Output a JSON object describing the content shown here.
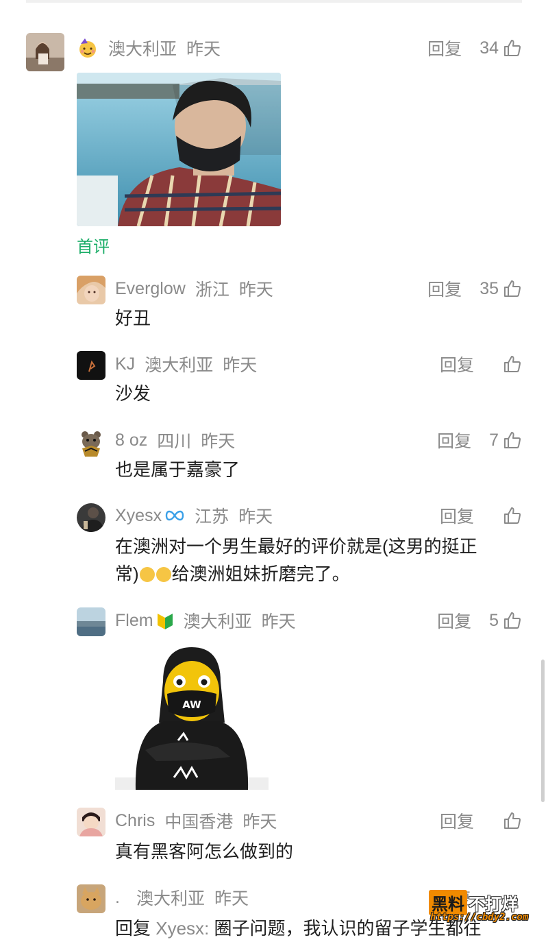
{
  "comments": [
    {
      "name": "",
      "badge_icon": "party-face-emoji",
      "region": "澳大利亚",
      "time": "昨天",
      "reply": "回复",
      "likes": "34",
      "tag": "首评"
    },
    {
      "name": "Everglow",
      "region": "浙江",
      "time": "昨天",
      "reply": "回复",
      "likes": "35",
      "text": "好丑"
    },
    {
      "name": "KJ",
      "region": "澳大利亚",
      "time": "昨天",
      "reply": "回复",
      "likes": "",
      "text": "沙发"
    },
    {
      "name": "8 oz",
      "region": "四川",
      "time": "昨天",
      "reply": "回复",
      "likes": "7",
      "text": "也是属于嘉豪了"
    },
    {
      "name": "Xyesx",
      "badge_icon": "infinity-badge-icon",
      "region": "江苏",
      "time": "昨天",
      "reply": "回复",
      "likes": "",
      "text_line1": "在澳洲对一个男生最好的评价就是(这男的挺正",
      "text_line2_a": "常)",
      "text_line2_b": "给澳洲姐妹折磨完了。"
    },
    {
      "name": "Flem",
      "badge_icon": "beginner-badge-icon",
      "region": "澳大利亚",
      "time": "昨天",
      "reply": "回复",
      "likes": "5"
    },
    {
      "name": "Chris",
      "region": "中国香港",
      "time": "昨天",
      "reply": "回复",
      "likes": "",
      "text": "真有黑客阿怎么做到的"
    },
    {
      "name": ".",
      "region": "澳大利亚",
      "time": "昨天",
      "reply": "回复",
      "reply_prefix": "回复",
      "reply_target": "Xyesx",
      "reply_text": "圈子问题，我认识的留子学生都往"
    }
  ],
  "sticker_mask_text": "AW",
  "watermark": {
    "title_a": "黑料",
    "title_b": "不打烊",
    "url": "https://cbdy2.com"
  },
  "colors": {
    "meta": "#8a8a8a",
    "text": "#1f1f1f",
    "first_tag": "#1aad67",
    "watermark": "#f08a00"
  }
}
